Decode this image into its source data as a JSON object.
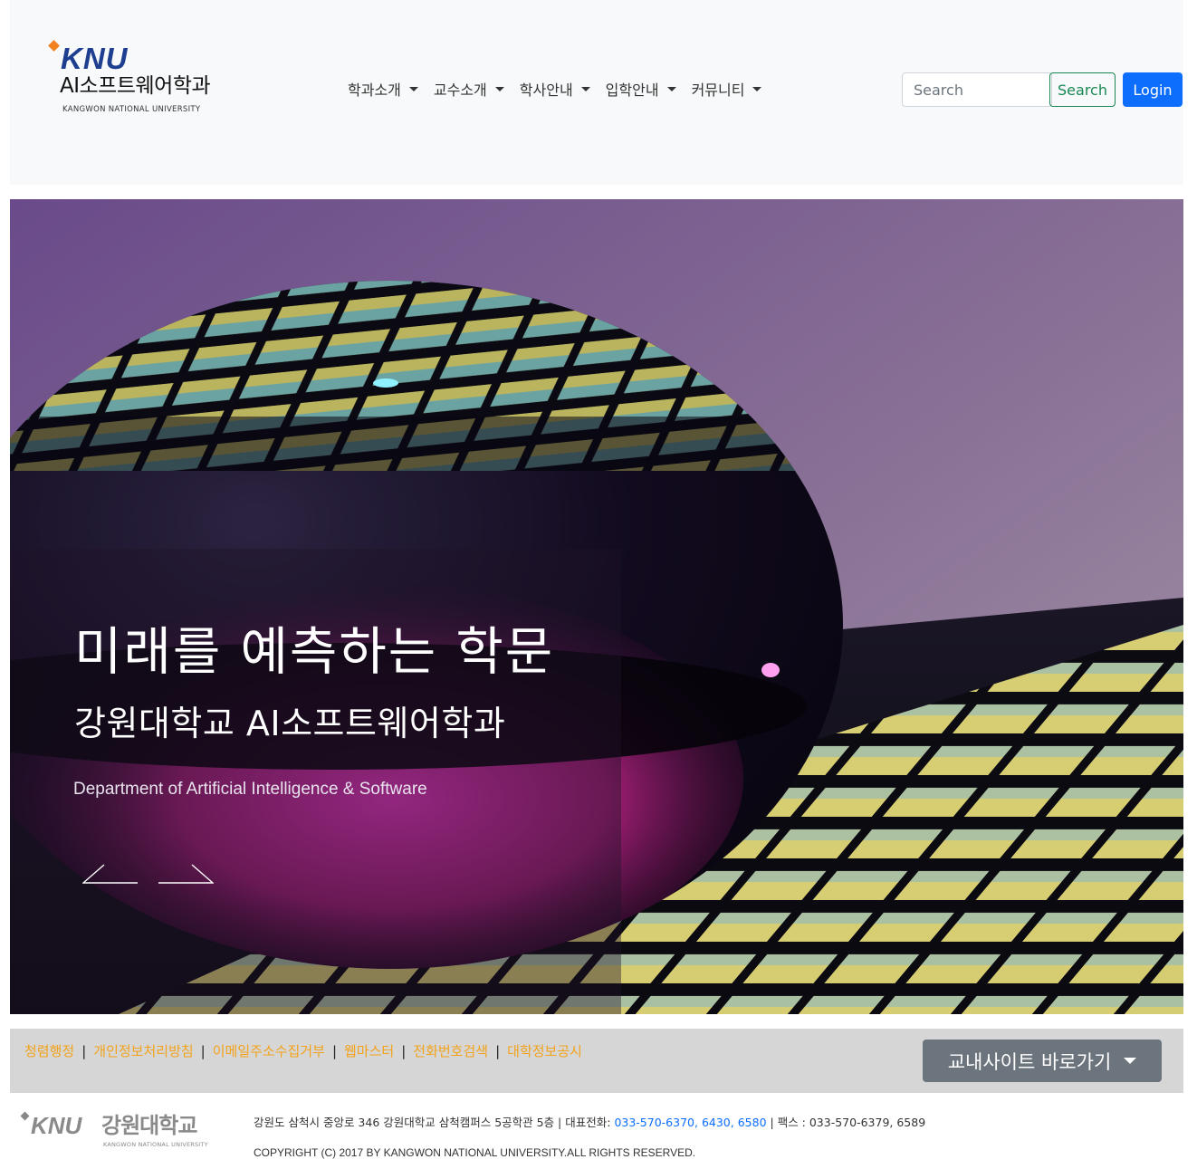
{
  "header": {
    "logo": {
      "knu": "KNU",
      "title": "AI소프트웨어학과",
      "subtitle": "KANGWON NATIONAL UNIVERSITY"
    },
    "menu": [
      {
        "label": "학과소개"
      },
      {
        "label": "교수소개"
      },
      {
        "label": "학사안내"
      },
      {
        "label": "입학안내"
      },
      {
        "label": "커뮤니티"
      }
    ],
    "search_placeholder": "Search",
    "search_button": "Search",
    "login_button": "Login",
    "colors": {
      "background": "#f8f9fa",
      "search_outline": "#198754",
      "login_bg": "#0d6efd"
    }
  },
  "hero": {
    "title": "미래를 예측하는 학문",
    "subtitle": "강원대학교 AI소프트웨어학과",
    "english": "Department of Artificial Intelligence & Software",
    "prev_icon": "arrow-left-icon",
    "next_icon": "arrow-right-icon"
  },
  "footer": {
    "links": [
      {
        "label": "청렴행정"
      },
      {
        "label": "개인정보처리방침"
      },
      {
        "label": "이메일주소수집거부"
      },
      {
        "label": "웹마스터"
      },
      {
        "label": "전화번호검색"
      },
      {
        "label": "대학정보공시"
      }
    ],
    "separator": "|",
    "dropdown_label": "교내사이트 바로가기",
    "logo": {
      "knu": "KNU",
      "name": "강원대학교",
      "subtitle": "KANGWON NATIONAL UNIVERSITY"
    },
    "address_prefix": "강원도 삼척시 중앙로 346 강원대학교 삼척캠퍼스 5공학관 5층 | 대표전화: ",
    "phones": [
      "033-570-6370",
      "6430",
      "6580"
    ],
    "fax": " | 팩스 : 033-570-6379, 6589",
    "copyright": "COPYRIGHT (C) 2017 BY KANGWON NATIONAL UNIVERSITY.ALL RIGHTS RESERVED.",
    "colors": {
      "link": "#f2a31b",
      "bar": "#d6d6d6",
      "dropdown": "#6c757d"
    }
  }
}
